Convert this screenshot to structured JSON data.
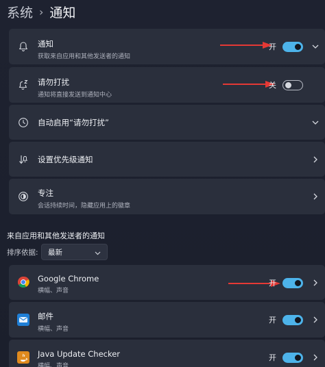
{
  "breadcrumb": {
    "root": "系统",
    "separator": "›",
    "current": "通知"
  },
  "settings": [
    {
      "title": "通知",
      "sub": "获取来自应用和其他发送者的通知",
      "state": "开",
      "toggle_on": true,
      "chevron": "chevron-down",
      "icon": "bell-icon"
    },
    {
      "title": "请勿打扰",
      "sub": "通知将直接发送到通知中心",
      "state": "关",
      "toggle_on": false,
      "icon": "bell-snooze-icon"
    },
    {
      "title": "自动启用“请勿打扰”",
      "chevron": "chevron-down",
      "icon": "clock-icon"
    },
    {
      "title": "设置优先级通知",
      "chevron": "chevron-right",
      "icon": "priority-icon"
    },
    {
      "title": "专注",
      "sub": "会话持续时间，隐藏应用上的徽章",
      "chevron": "chevron-right",
      "icon": "focus-icon"
    }
  ],
  "apps_section": {
    "title": "来自应用和其他发送者的通知",
    "sort_label": "排序依据:",
    "sort_value": "最新"
  },
  "apps": [
    {
      "title": "Google Chrome",
      "sub": "横幅、声音",
      "state": "开",
      "toggle_on": true,
      "icon": "chrome-icon"
    },
    {
      "title": "邮件",
      "sub": "横幅、声音",
      "state": "开",
      "toggle_on": true,
      "icon": "mail-icon"
    },
    {
      "title": "Java Update Checker",
      "sub": "横幅、声音",
      "state": "开",
      "toggle_on": true,
      "icon": "java-icon"
    }
  ],
  "colors": {
    "accent": "#4db3ea",
    "arrow": "#e53935",
    "card": "#2a2f3c",
    "background": "#1d2130"
  }
}
